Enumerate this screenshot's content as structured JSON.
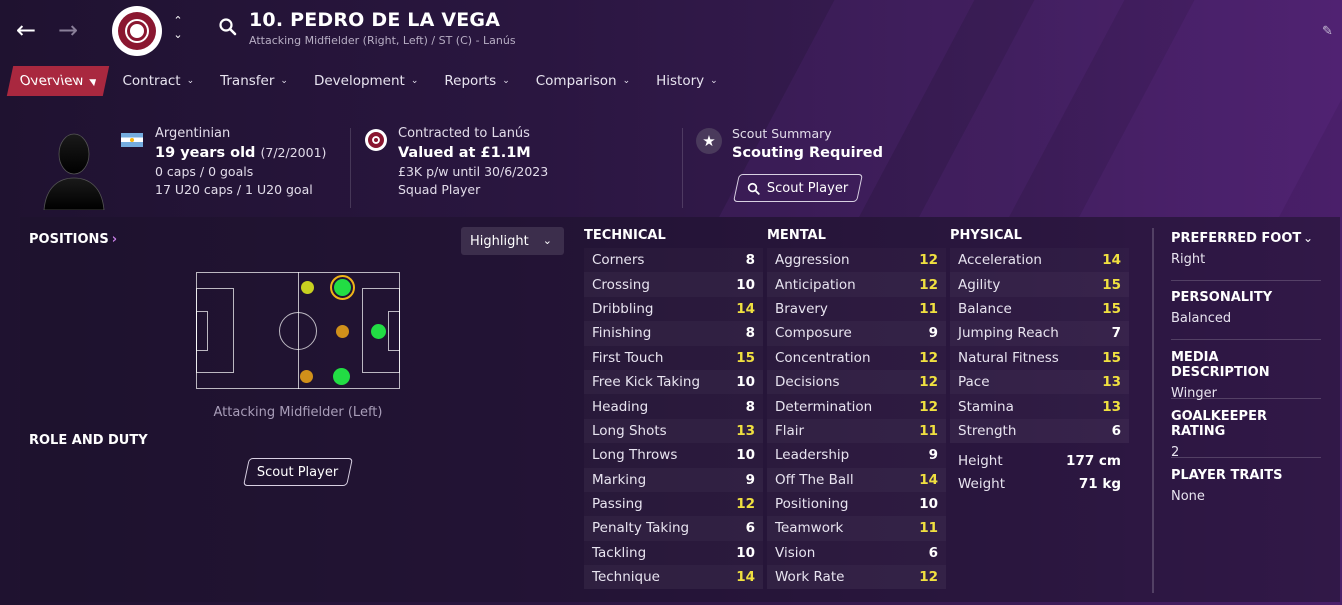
{
  "header": {
    "title": "10. PEDRO DE LA VEGA",
    "subtitle": "Attacking Midfielder (Right, Left) / ST (C) - Lanús"
  },
  "menu": [
    {
      "label": "Overview",
      "active": true
    },
    {
      "label": "Contract"
    },
    {
      "label": "Transfer"
    },
    {
      "label": "Development"
    },
    {
      "label": "Reports"
    },
    {
      "label": "Comparison"
    },
    {
      "label": "History"
    }
  ],
  "info": {
    "nationality": "Argentinian",
    "age": "19 years old",
    "dob": "(7/2/2001)",
    "caps": "0 caps / 0 goals",
    "u20": "17 U20 caps / 1 U20 goal",
    "contract_label": "Contracted to Lanús",
    "value": "Valued at £1.1M",
    "wage": "£3K p/w until 30/6/2023",
    "squad_status": "Squad Player",
    "scout_label": "Scout Summary",
    "scout_status": "Scouting Required",
    "scout_button": "Scout Player"
  },
  "positions": {
    "title": "POSITIONS",
    "highlight": "Highlight",
    "caption": "Attacking Midfielder (Left)",
    "role_title": "ROLE AND DUTY",
    "role_button": "Scout Player"
  },
  "attributes": {
    "technical": {
      "title": "TECHNICAL",
      "rows": [
        {
          "name": "Corners",
          "value": "8"
        },
        {
          "name": "Crossing",
          "value": "10"
        },
        {
          "name": "Dribbling",
          "value": "14"
        },
        {
          "name": "Finishing",
          "value": "8"
        },
        {
          "name": "First Touch",
          "value": "15"
        },
        {
          "name": "Free Kick Taking",
          "value": "10"
        },
        {
          "name": "Heading",
          "value": "8"
        },
        {
          "name": "Long Shots",
          "value": "13"
        },
        {
          "name": "Long Throws",
          "value": "10"
        },
        {
          "name": "Marking",
          "value": "9"
        },
        {
          "name": "Passing",
          "value": "12"
        },
        {
          "name": "Penalty Taking",
          "value": "6"
        },
        {
          "name": "Tackling",
          "value": "10"
        },
        {
          "name": "Technique",
          "value": "14"
        }
      ]
    },
    "mental": {
      "title": "MENTAL",
      "rows": [
        {
          "name": "Aggression",
          "value": "12"
        },
        {
          "name": "Anticipation",
          "value": "12"
        },
        {
          "name": "Bravery",
          "value": "11"
        },
        {
          "name": "Composure",
          "value": "9"
        },
        {
          "name": "Concentration",
          "value": "12"
        },
        {
          "name": "Decisions",
          "value": "12"
        },
        {
          "name": "Determination",
          "value": "12"
        },
        {
          "name": "Flair",
          "value": "11"
        },
        {
          "name": "Leadership",
          "value": "9"
        },
        {
          "name": "Off The Ball",
          "value": "14"
        },
        {
          "name": "Positioning",
          "value": "10"
        },
        {
          "name": "Teamwork",
          "value": "11"
        },
        {
          "name": "Vision",
          "value": "6"
        },
        {
          "name": "Work Rate",
          "value": "12"
        }
      ]
    },
    "physical": {
      "title": "PHYSICAL",
      "rows": [
        {
          "name": "Acceleration",
          "value": "14"
        },
        {
          "name": "Agility",
          "value": "15"
        },
        {
          "name": "Balance",
          "value": "15"
        },
        {
          "name": "Jumping Reach",
          "value": "7"
        },
        {
          "name": "Natural Fitness",
          "value": "15"
        },
        {
          "name": "Pace",
          "value": "13"
        },
        {
          "name": "Stamina",
          "value": "13"
        },
        {
          "name": "Strength",
          "value": "6"
        }
      ]
    },
    "height_label": "Height",
    "height": "177 cm",
    "weight_label": "Weight",
    "weight": "71 kg"
  },
  "side": {
    "preferred_foot_title": "PREFERRED FOOT",
    "preferred_foot": "Right",
    "personality_title": "PERSONALITY",
    "personality": "Balanced",
    "media_title": "MEDIA DESCRIPTION",
    "media": "Winger",
    "gk_title": "GOALKEEPER RATING",
    "gk": "2",
    "traits_title": "PLAYER TRAITS",
    "traits": "None"
  },
  "colors": {
    "highlight_value": "#f0e040",
    "accent": "#a9283f",
    "natural": "#22dd44",
    "accomplished": "#c8d020",
    "unconvincing": "#d0901a"
  }
}
